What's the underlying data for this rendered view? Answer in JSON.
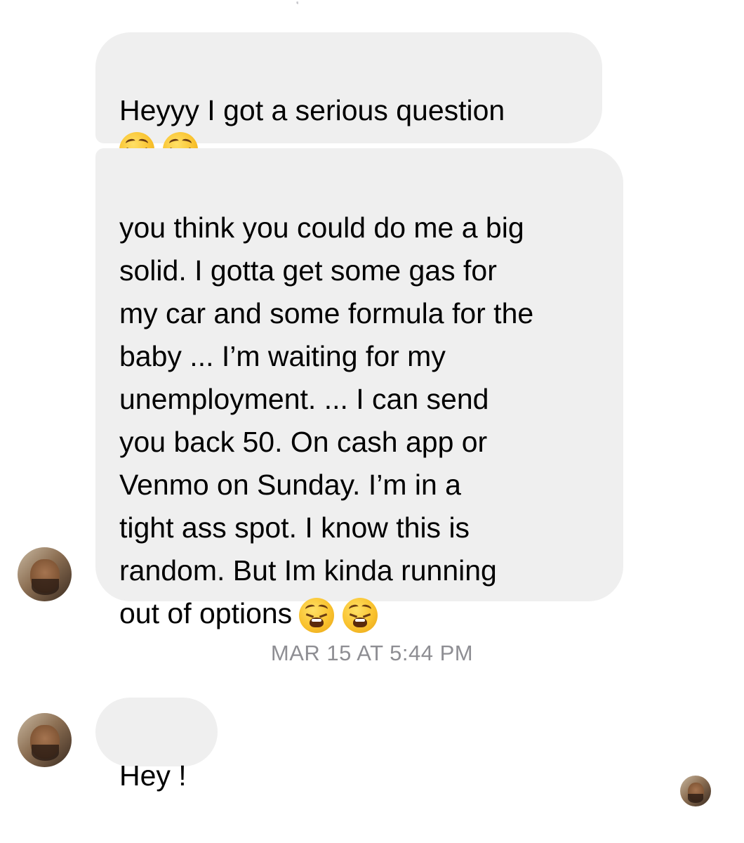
{
  "conversation": {
    "messages": [
      {
        "text": "Heyyy  I got a serious question",
        "emoji": [
          "weary-face",
          "weary-face"
        ]
      },
      {
        "text": "you think you could do me a big\nsolid.   I gotta get some gas for\nmy car and some formula for the\nbaby ...  I’m waiting for my\nunemployment.  ... I can send\nyou back 50.   On cash app or\nVenmo on Sunday.      I’m in a\ntight ass spot.   I know this is\nrandom.  But Im kinda running\nout of options",
        "emoji": [
          "weary-face",
          "weary-face"
        ]
      },
      {
        "text": "Hey !"
      }
    ],
    "timestamp": "MAR 15 AT 5:44 PM"
  },
  "colors": {
    "bubble_background": "#efefef",
    "timestamp_text": "#8e8e93",
    "page_background": "#ffffff"
  }
}
